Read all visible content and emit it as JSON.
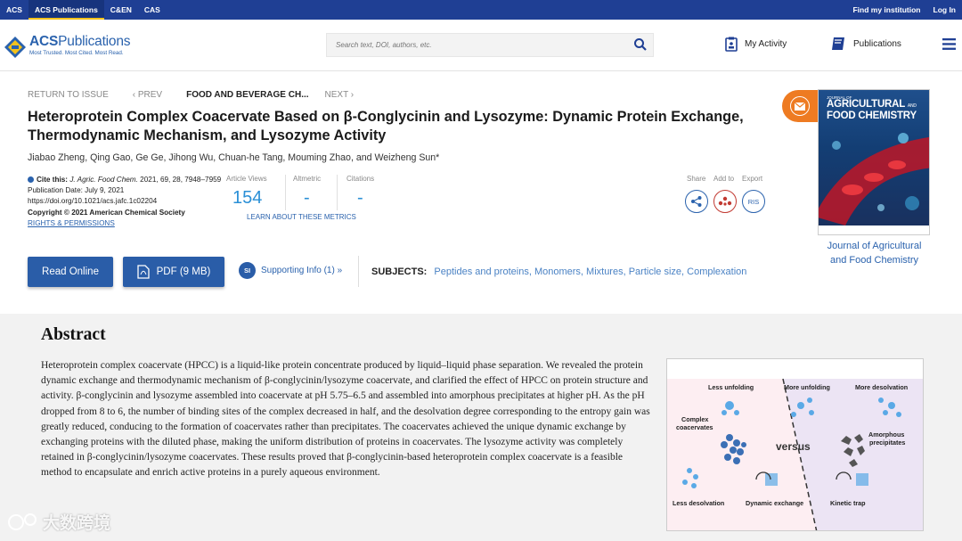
{
  "topbar": {
    "left": [
      "ACS",
      "ACS Publications",
      "C&EN",
      "CAS"
    ],
    "right": [
      "Find my institution",
      "Log In"
    ]
  },
  "header": {
    "logo_brand_bold": "ACS",
    "logo_brand_rest": "Publications",
    "logo_tagline": "Most Trusted. Most Cited. Most Read.",
    "search_placeholder": "Search text, DOI, authors, etc.",
    "my_activity": "My Activity",
    "publications": "Publications"
  },
  "breadcrumb": {
    "return": "RETURN TO ISSUE",
    "prev": "‹ PREV",
    "current": "FOOD AND BEVERAGE CH...",
    "next": "NEXT ›"
  },
  "article": {
    "title": "Heteroprotein Complex Coacervate Based on β-Conglycinin and Lysozyme: Dynamic Protein Exchange, Thermodynamic Mechanism, and Lysozyme Activity",
    "authors": "Jiabao Zheng, Qing Gao, Ge Ge, Jihong Wu, Chuan-he Tang, Mouming Zhao, and Weizheng Sun*",
    "cite_label": "Cite this:",
    "cite_journal": "J. Agric. Food Chem.",
    "cite_ref": " 2021, 69, 28, 7948–7959",
    "pub_date": "Publication Date: July 9, 2021",
    "doi": "https://doi.org/10.1021/acs.jafc.1c02204",
    "copyright": "Copyright © 2021 American Chemical Society",
    "rights": "RIGHTS & PERMISSIONS"
  },
  "metrics": {
    "views_label": "Article Views",
    "views": "154",
    "altmetric_label": "Altmetric",
    "altmetric": "-",
    "citations_label": "Citations",
    "citations": "-",
    "learn": "LEARN ABOUT THESE METRICS"
  },
  "actions": {
    "share": "Share",
    "add_to": "Add to",
    "export": "Export",
    "ris": "RIS"
  },
  "buttons": {
    "read_online": "Read Online",
    "pdf": "PDF (9 MB)",
    "si_badge": "SI",
    "supporting_info": "Supporting Info (1) »"
  },
  "subjects": {
    "label": "SUBJECTS:",
    "items": [
      "Peptides and proteins,",
      "Monomers,",
      "Mixtures,",
      "Particle size,",
      "Complexation"
    ]
  },
  "journal_cover": {
    "small": "JOURNAL OF",
    "line1": "AGRICULTURAL",
    "and": "AND",
    "line2": "FOOD CHEMISTRY",
    "link": "Journal of Agricultural and Food Chemistry"
  },
  "abstract": {
    "heading": "Abstract",
    "text": "Heteroprotein complex coacervate (HPCC) is a liquid-like protein concentrate produced by liquid–liquid phase separation. We revealed the protein dynamic exchange and thermodynamic mechanism of β-conglycinin/lysozyme coacervate, and clarified the effect of HPCC on protein structure and activity. β-conglycinin and lysozyme assembled into coacervate at pH 5.75–6.5 and assembled into amorphous precipitates at higher pH. As the pH dropped from 8 to 6, the number of binding sites of the complex decreased in half, and the desolvation degree corresponding to the entropy gain was greatly reduced, conducing to the formation of coacervates rather than precipitates. The coacervates achieved the unique dynamic exchange by exchanging proteins with the diluted phase, making the uniform distribution of proteins in coacervates. The lysozyme activity was completely retained in β-conglycinin/lysozyme coacervates. These results proved that β-conglycinin-based heteroprotein complex coacervate is a feasible method to encapsulate and enrich active proteins in a purely aqueous environment."
  },
  "toc_graphic": {
    "less_unfolding": "Less unfolding",
    "more_unfolding": "More unfolding",
    "more_desolvation": "More desolvation",
    "complex_coacervates_1": "Complex",
    "complex_coacervates_2": "coacervates",
    "versus": "versus",
    "amorphous_1": "Amorphous",
    "amorphous_2": "precipitates",
    "less_desolvation": "Less desolvation",
    "dynamic_exchange": "Dynamic exchange",
    "kinetic_trap": "Kinetic trap"
  },
  "watermark": "大数跨境",
  "colors": {
    "topbar": "#1f3f94",
    "brand_blue": "#2a62ad",
    "button": "#2a5da8",
    "email_orange": "#ee7b22",
    "abstract_bg": "#f2f2f2"
  }
}
